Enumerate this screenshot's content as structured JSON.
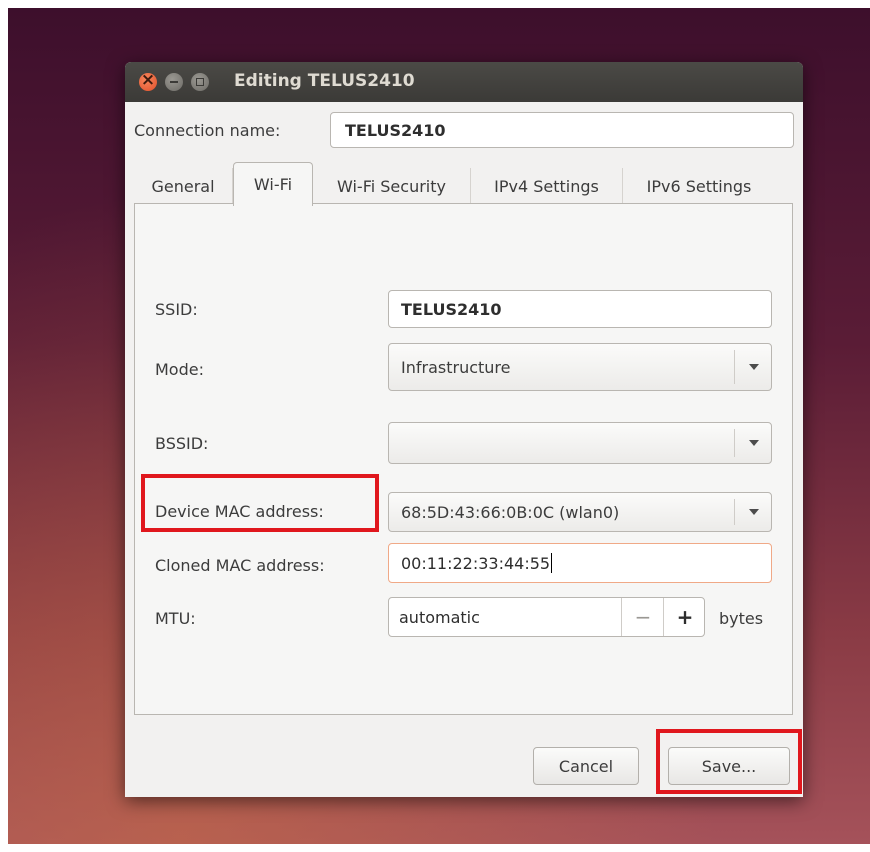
{
  "window": {
    "title": "Editing TELUS2410"
  },
  "connection": {
    "name_label": "Connection name:",
    "name_value": "TELUS2410"
  },
  "tabs": [
    {
      "label": "General"
    },
    {
      "label": "Wi-Fi"
    },
    {
      "label": "Wi-Fi Security"
    },
    {
      "label": "IPv4 Settings"
    },
    {
      "label": "IPv6 Settings"
    }
  ],
  "wifi": {
    "ssid_label": "SSID:",
    "ssid_value": "TELUS2410",
    "mode_label": "Mode:",
    "mode_value": "Infrastructure",
    "bssid_label": "BSSID:",
    "bssid_value": "",
    "device_mac_label": "Device MAC address:",
    "device_mac_value": "68:5D:43:66:0B:0C (wlan0)",
    "cloned_mac_label": "Cloned MAC address:",
    "cloned_mac_value": "00:11:22:33:44:55",
    "mtu_label": "MTU:",
    "mtu_value": "automatic",
    "mtu_minus": "−",
    "mtu_plus": "+",
    "mtu_unit": "bytes"
  },
  "buttons": {
    "cancel": "Cancel",
    "save": "Save..."
  },
  "colors": {
    "highlight": "#e0171d",
    "titlebar": "#3b3a37",
    "focus_border": "#f0a987"
  }
}
